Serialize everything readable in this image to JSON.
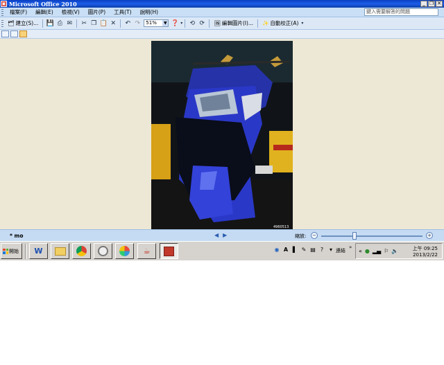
{
  "window": {
    "title": "Microsoft Office 2010",
    "app_icon": "office-icon"
  },
  "menu": {
    "items": [
      "檔案(F)",
      "編輯(E)",
      "檢視(V)",
      "圖片(P)",
      "工具(T)",
      "說明(H)"
    ],
    "help_placeholder": "鍵入需要解答的問題"
  },
  "toolbar": {
    "share_label": "建立(S)...",
    "zoom_value": "51%",
    "edit_picture_label": "編輯圖片(I)...",
    "auto_correct_label": "自動校正(A)"
  },
  "status": {
    "filename": "* mo",
    "zoom_label": "縮放:"
  },
  "taskbar": {
    "start_label": "開始",
    "links_label": "連結",
    "time": "上午 09:25",
    "date": "2013/2/22"
  },
  "photo": {
    "watermark": "4960513"
  },
  "colors": {
    "titlebar": "#0a3fc2",
    "menubar": "#c9dff5",
    "viewer_bg": "#ede8d6",
    "taskbar": "#d6d3ce",
    "scooter_blue": "#2a38c8"
  }
}
